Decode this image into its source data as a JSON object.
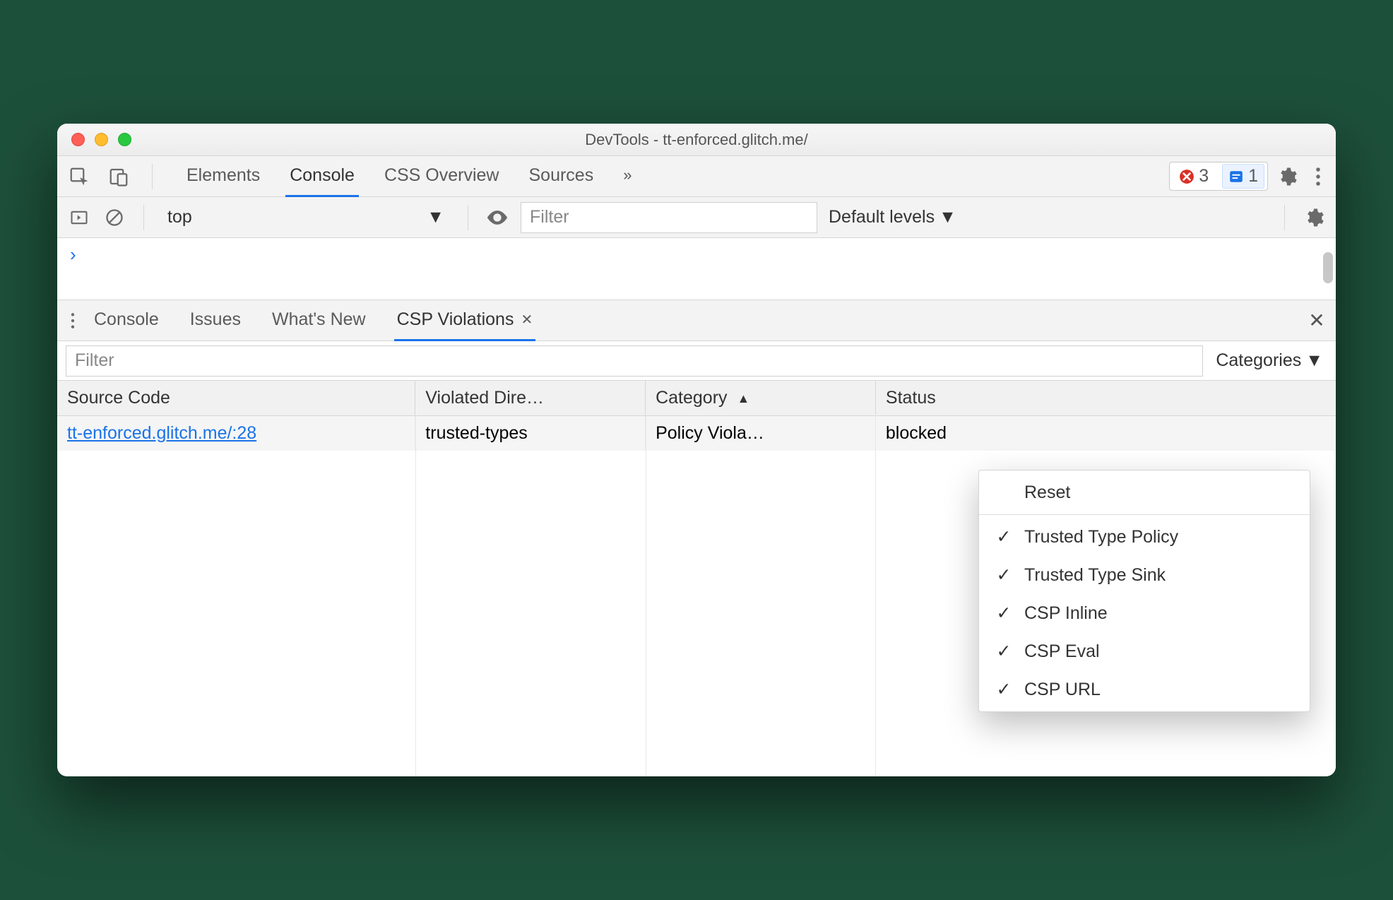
{
  "window": {
    "title": "DevTools - tt-enforced.glitch.me/"
  },
  "tabstrip": {
    "tabs": [
      "Elements",
      "Console",
      "CSS Overview",
      "Sources"
    ],
    "active": "Console",
    "errors_count": "3",
    "issues_count": "1"
  },
  "consolebar": {
    "context": "top",
    "filter_placeholder": "Filter",
    "levels_label": "Default levels"
  },
  "drawer": {
    "tabs": [
      "Console",
      "Issues",
      "What's New",
      "CSP Violations"
    ],
    "active": "CSP Violations"
  },
  "filter": {
    "placeholder": "Filter",
    "categories_label": "Categories"
  },
  "table": {
    "columns": [
      "Source Code",
      "Violated Dire…",
      "Category",
      "Status"
    ],
    "sort_column": "Category",
    "rows": [
      {
        "source": "tt-enforced.glitch.me/:28",
        "directive": "trusted-types",
        "category": "Policy Viola…",
        "status": "blocked"
      }
    ]
  },
  "dropdown": {
    "reset": "Reset",
    "items": [
      "Trusted Type Policy",
      "Trusted Type Sink",
      "CSP Inline",
      "CSP Eval",
      "CSP URL"
    ]
  }
}
